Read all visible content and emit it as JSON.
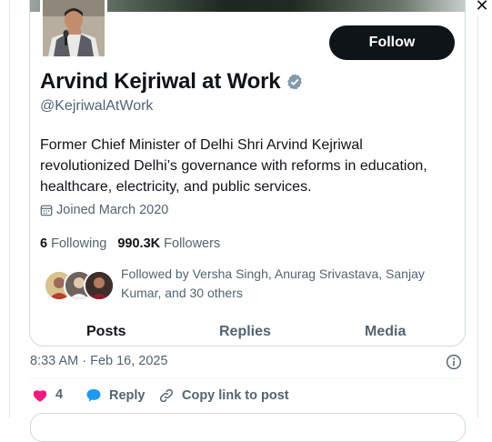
{
  "profile": {
    "follow_label": "Follow",
    "name": "Arvind Kejriwal at Work",
    "handle": "@KejriwalAtWork",
    "bio": "Former Chief Minister of Delhi Shri Arvind Kejriwal revolutionized Delhi’s governance with reforms in education, healthcare, electricity, and public services.",
    "joined": "Joined March 2020",
    "following_count": "6",
    "following_label": "Following",
    "followers_count": "990.3K",
    "followers_label": "Followers",
    "followed_by": "Followed by Versha Singh, Anurag Srivastava, Sanjay Kumar, and 30 others",
    "tabs": [
      "Posts",
      "Replies",
      "Media"
    ],
    "verified_color": "#829aab",
    "icons": [
      "calendar-icon",
      "verified-badge-icon"
    ]
  },
  "tweet": {
    "timestamp": "8:33 AM · Feb 16, 2025",
    "like_count": "4",
    "reply_label": "Reply",
    "copy_link_label": "Copy link to post",
    "like_color": "#f91880",
    "reply_color": "#1d9bf0",
    "icons": [
      "heart-icon",
      "reply-bubble-icon",
      "link-icon",
      "info-icon",
      "close-icon"
    ]
  }
}
